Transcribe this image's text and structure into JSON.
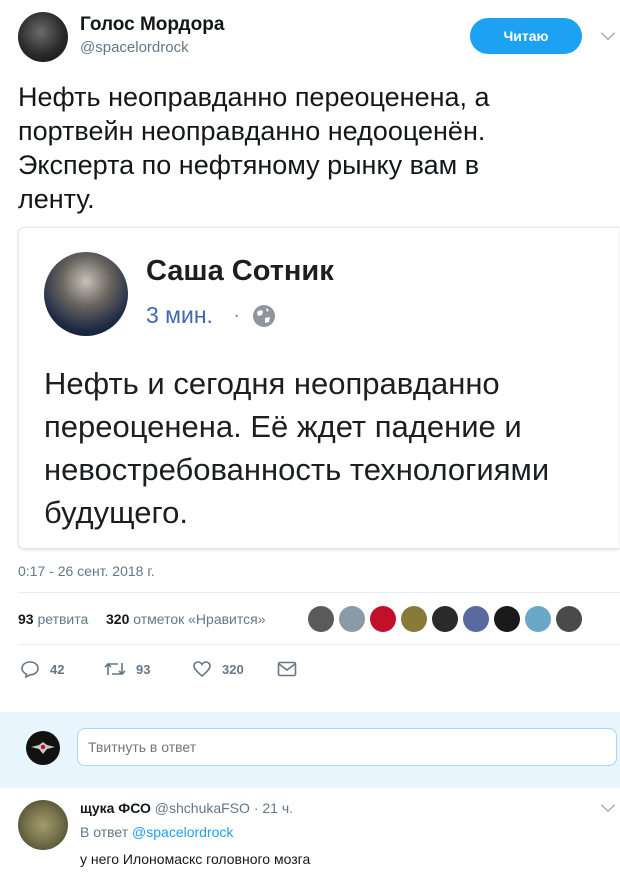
{
  "author": {
    "name": "Голос Мордора",
    "handle": "@spacelordrock"
  },
  "follow_button": "Читаю",
  "tweet": {
    "line1": "Нефть неоправданно переоценена, а",
    "line2": "портвейн неоправданно недооценён.",
    "line3": "Эксперта по нефтяному рынку вам в",
    "line4": "ленту."
  },
  "embed": {
    "name": "Саша Сотник",
    "time": "3 мин.",
    "separator": "·",
    "line1": "Нефть и сегодня неоправданно",
    "line2": "переоценена. Её ждет падение и",
    "line3": "невостребованность технологиями",
    "line4": "будущего."
  },
  "timestamp": "0:17 - 26 сент. 2018 г.",
  "stats": {
    "retweets_count": "93",
    "retweets_label": "ретвита",
    "likes_count": "320",
    "likes_label": "отметок «Нравится»"
  },
  "likers_colors": [
    "#5a5a5a",
    "#8a9aa6",
    "#c0102a",
    "#8a7a3a",
    "#2a2a2a",
    "#5a6aa0",
    "#1a1a1a",
    "#6aa8c8",
    "#4a4a4a"
  ],
  "actions": {
    "replies": "42",
    "retweets": "93",
    "likes": "320"
  },
  "reply_box": {
    "placeholder": "Твитнуть в ответ"
  },
  "reply": {
    "name": "щука ФСО",
    "handle": "@shchukaFSO",
    "dot": "·",
    "time": "21 ч.",
    "in_reply_prefix": "В ответ",
    "in_reply_handle": "@spacelordrock",
    "text": "у него Илономаскс головного мозга"
  }
}
